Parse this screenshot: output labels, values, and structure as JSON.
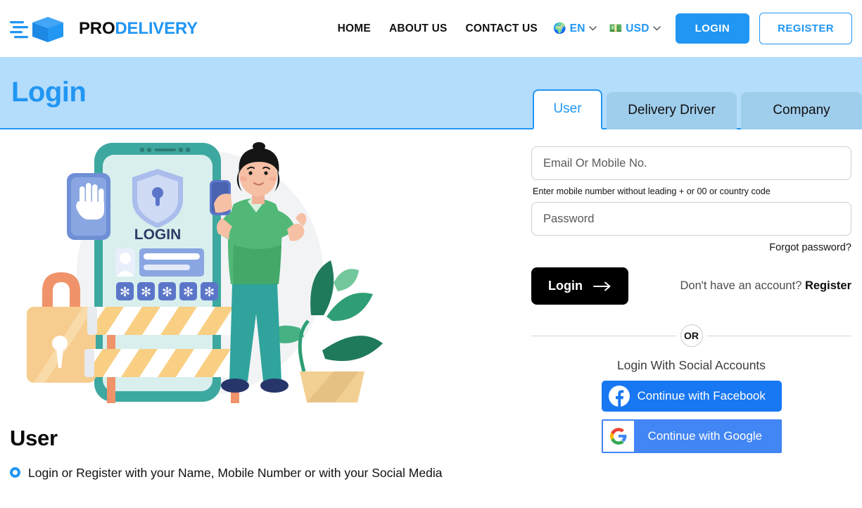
{
  "header": {
    "logo": {
      "primary": "PRO",
      "secondary": "DELIVERY",
      "icon": "delivery-box-icon"
    },
    "nav": [
      {
        "label": "HOME",
        "name": "nav-home"
      },
      {
        "label": "ABOUT US",
        "name": "nav-about-us"
      },
      {
        "label": "CONTACT US",
        "name": "nav-contact-us"
      }
    ],
    "language": {
      "icon": "🌍",
      "label": "EN"
    },
    "currency": {
      "icon": "💵",
      "label": "USD"
    },
    "login_button": "LOGIN",
    "register_button": "REGISTER"
  },
  "banner": {
    "title": "Login",
    "background": "#b4dcfb",
    "accent": "#2196f3"
  },
  "tabs": [
    {
      "label": "User",
      "active": true
    },
    {
      "label": "Delivery Driver",
      "active": false
    },
    {
      "label": "Company",
      "active": false
    }
  ],
  "illustration": {
    "phone_screen_label": "LOGIN",
    "alt": "login security illustration with smartphone, padlock, barricade and woman holding phone"
  },
  "form": {
    "email_placeholder": "Email Or Mobile No.",
    "email_value": "",
    "helper_text": "Enter mobile number without leading + or 00 or country code",
    "password_placeholder": "Password",
    "password_value": "",
    "forgot_password": "Forgot password?",
    "login_button": "Login",
    "no_account_text": "Don't have an account? ",
    "register_link": "Register",
    "divider_label": "OR",
    "social_title": "Login With Social Accounts",
    "facebook_button": "Continue with Facebook",
    "google_button": "Continue with Google",
    "facebook_color": "#1877f2",
    "google_color": "#4285f4"
  },
  "info": {
    "heading": "User",
    "bullets": [
      "Login or Register with your Name, Mobile Number or with your Social Media"
    ]
  }
}
